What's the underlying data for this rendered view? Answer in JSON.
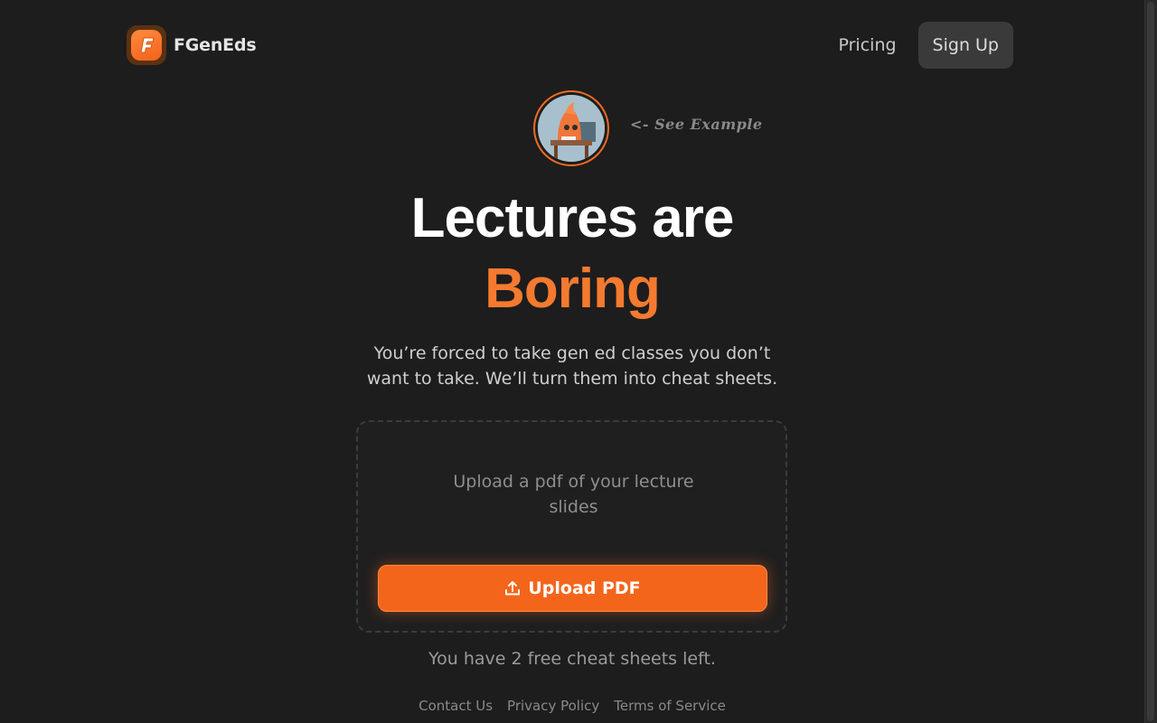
{
  "brand": {
    "name": "FGenEds",
    "logo_letter": "F",
    "accent_color": "#f4651c"
  },
  "nav": {
    "pricing_label": "Pricing",
    "signup_label": "Sign Up"
  },
  "example": {
    "label": "<- See Example"
  },
  "hero": {
    "title_line1": "Lectures are",
    "title_line2": "Boring",
    "subtitle": "You’re forced to take gen ed classes you don’t want to take. We’ll turn them into cheat sheets."
  },
  "upload": {
    "prompt": "Upload a pdf of your lecture slides",
    "button_label": "Upload PDF",
    "button_icon": "upload-icon"
  },
  "credits_text": "You have 2 free cheat sheets left.",
  "footer": {
    "links": [
      "Contact Us",
      "Privacy Policy",
      "Terms of Service"
    ]
  }
}
